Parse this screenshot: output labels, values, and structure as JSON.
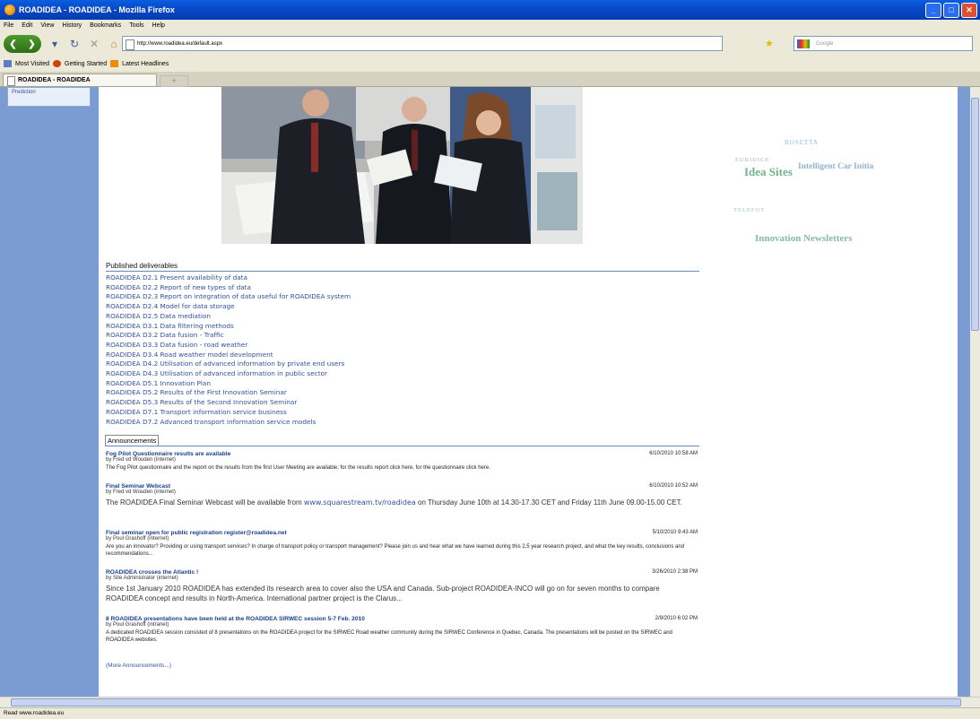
{
  "window": {
    "title": "ROADIDEA - ROADIDEA - Mozilla Firefox"
  },
  "menu": [
    "File",
    "Edit",
    "View",
    "History",
    "Bookmarks",
    "Tools",
    "Help"
  ],
  "nav": {
    "url": "http://www.roadidea.eu/default.aspx",
    "search_placeholder": "Google"
  },
  "bookmarks": [
    "Most Visited",
    "Getting Started",
    "Latest Headlines"
  ],
  "tab": {
    "title": "ROADIDEA - ROADIDEA",
    "new_tab": "+"
  },
  "sidebar": {
    "item": "Prediction"
  },
  "tagcloud": [
    "ROSETTA",
    "EURIDICE",
    "Idea Sites",
    "Intelligent Car Initia",
    "TELEFOT",
    "Innovation Newsletters"
  ],
  "deliverables": {
    "heading": "Published deliverables",
    "items": [
      "ROADIDEA D2.1 Present availability of data",
      "ROADIDEA D2.2 Report of new types of data",
      "ROADIDEA D2.3 Report on integration of data useful for ROADIDEA system",
      "ROADIDEA D2.4 Model for data storage",
      "ROADIDEA D2.5 Data mediation",
      "ROADIDEA D3.1 Data filtering methods",
      "ROADIDEA D3.2 Data fusion - Traffic",
      "ROADIDEA D3.3 Data fusion - road weather",
      "ROADIDEA D3.4 Road weather model development",
      "ROADIDEA D4.2 Utilisation of advanced information by private end users",
      "ROADIDEA D4.3 Utilisation of advanced information in public sector",
      "ROADIDEA D5.1 Innovation Plan",
      "ROADIDEA D5.2 Results of the First Innovation Seminar",
      "ROADIDEA D5.3 Results of the Second Innovation Seminar",
      "ROADIDEA D7.1 Transport information service business",
      "ROADIDEA D7.2 Advanced transport information service models"
    ]
  },
  "announcements": {
    "heading": "Announcements",
    "items": [
      {
        "title": "Fog Pilot Questionnaire results are available",
        "date": "6/10/2010 10:58 AM",
        "by": "by Fred vd Wouden (internet)",
        "body": "The Fog Pilot questionnaire and the report on the results from the first User Meeting are available; for the results report click here, for the questionnaire click here."
      },
      {
        "title": "Final Seminar Webcast",
        "date": "6/10/2010 10:52 AM",
        "by": "by Fred vd Wouden (internet)",
        "body_pre": "The ROADIDEA Final Seminar Webcast will be available from ",
        "body_link": "www.squarestream.tv/roadidea",
        "body_post": " on Thursday June 10th at 14.30-17.30 CET and Friday 11th June 09.00-15.00 CET."
      },
      {
        "title": "Final seminar open for public registration register@roadidea.net",
        "date": "5/10/2010 9:43 AM",
        "by": "by Poul Grashoff (internet)",
        "body": "Are you an innovator? Providing or using transport services? In charge of transport policy or transport management? Please join us and hear what we have learned during this 2,5 year research project, and what the key results, conclusions and recommendations..."
      },
      {
        "title": "ROADIDEA crosses the Atlantic !",
        "date": "3/26/2010 2:38 PM",
        "by": "by Site Administrator (internet)",
        "body": "Since 1st January 2010 ROADIDEA has extended its research area to cover also the USA and Canada. Sub-project ROADIDEA-INCO will go on for seven months to compare ROADIDEA concept and results in North-America. International partner project is the Clarus..."
      },
      {
        "title": "8 ROADIDEA presentations have been held at the ROADIDEA SIRWEC session 5-7 Feb. 2010",
        "date": "2/9/2010 6:02 PM",
        "by": "by Poul Grashoff (intranet)",
        "body": "A dedicated ROADIDEA session consisted of 8 presentations on the ROADIDEA project for the SIRWEC Road weather community during the SIRWEC Conference in Quebec, Canada. The presentations will be posted on the SIRWEC and ROADIDEA websites."
      }
    ],
    "more": "(More Announcements...)"
  },
  "status": "Read www.roadidea.eu"
}
